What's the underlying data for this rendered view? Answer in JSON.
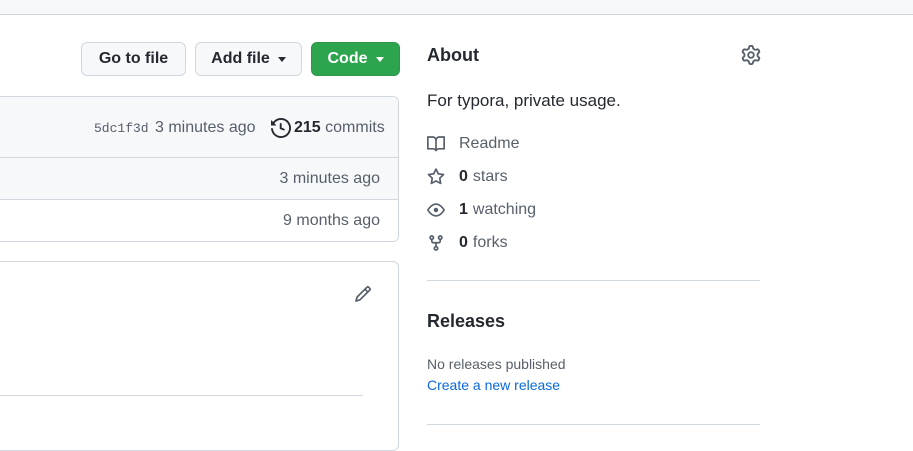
{
  "toolbar": {
    "go_to_file": "Go to file",
    "add_file": "Add file",
    "code": "Code"
  },
  "latest_commit": {
    "sha": "5dc1f3d",
    "time": "3 minutes ago",
    "commits_count": "215",
    "commits_label": "commits"
  },
  "files": [
    {
      "time": "3 minutes ago"
    },
    {
      "time": "9 months ago"
    }
  ],
  "about": {
    "title": "About",
    "description": "For typora, private usage.",
    "readme": "Readme",
    "stars_count": "0",
    "stars_label": "stars",
    "watching_count": "1",
    "watching_label": "watching",
    "forks_count": "0",
    "forks_label": "forks"
  },
  "releases": {
    "title": "Releases",
    "none": "No releases published",
    "create_link": "Create a new release"
  },
  "icons": {
    "history": "history-icon",
    "pencil": "pencil-icon",
    "gear": "gear-icon",
    "book": "book-icon",
    "star": "star-icon",
    "eye": "eye-icon",
    "fork": "fork-icon"
  },
  "colors": {
    "code_button": "#2da44e",
    "link": "#0969da",
    "muted_text": "#57606a",
    "border": "#d0d7de"
  }
}
